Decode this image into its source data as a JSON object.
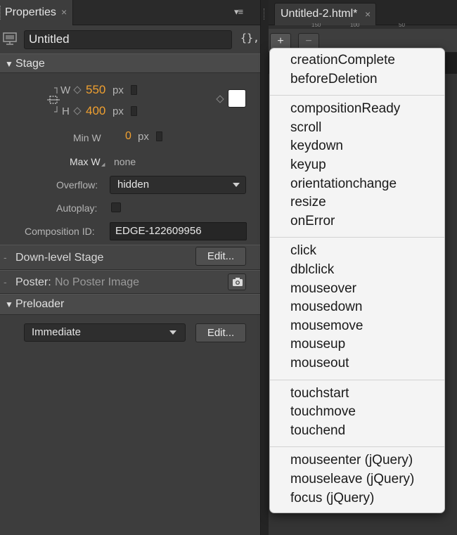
{
  "properties_panel": {
    "tab_label": "Properties",
    "tab_close": "×",
    "panel_menu_glyph": "▾≡",
    "stage_icon": "stage-icon",
    "symbol_name": "Untitled",
    "code_button_label": "{},",
    "stage_section": {
      "label": "Stage",
      "width_label": "W",
      "width_value": "550",
      "width_unit": "px",
      "height_label": "H",
      "height_value": "400",
      "height_unit": "px",
      "background_color": "#ffffff",
      "min_w_label": "Min W",
      "min_w_value": "0",
      "min_w_unit": "px",
      "max_w_label": "Max W",
      "max_w_value": "none",
      "overflow_label": "Overflow:",
      "overflow_value": "hidden",
      "autoplay_label": "Autoplay:",
      "autoplay_checked": false,
      "composition_id_label": "Composition ID:",
      "composition_id_value": "EDGE-122609956"
    },
    "downlevel_section": {
      "label": "Down-level Stage",
      "edit_label": "Edit..."
    },
    "poster_section": {
      "label": "Poster:",
      "value": "No Poster Image",
      "camera_icon": "camera-icon"
    },
    "preloader_section": {
      "label": "Preloader",
      "mode_value": "Immediate",
      "edit_label": "Edit..."
    }
  },
  "document": {
    "tab_label": "Untitled-2.html*",
    "tab_close": "×",
    "ruler_labels": [
      "150",
      "100",
      "50"
    ],
    "add_button": "+",
    "remove_button": "−"
  },
  "event_menu": {
    "groups": [
      [
        "creationComplete",
        "beforeDeletion"
      ],
      [
        "compositionReady",
        "scroll",
        "keydown",
        "keyup",
        "orientationchange",
        "resize",
        "onError"
      ],
      [
        "click",
        "dblclick",
        "mouseover",
        "mousedown",
        "mousemove",
        "mouseup",
        "mouseout"
      ],
      [
        "touchstart",
        "touchmove",
        "touchend"
      ],
      [
        "mouseenter (jQuery)",
        "mouseleave (jQuery)",
        "focus (jQuery)"
      ]
    ]
  },
  "colors": {
    "accent_orange": "#f0a030",
    "panel_bg": "#3d3d3d",
    "menu_bg": "#f4f4f4"
  }
}
